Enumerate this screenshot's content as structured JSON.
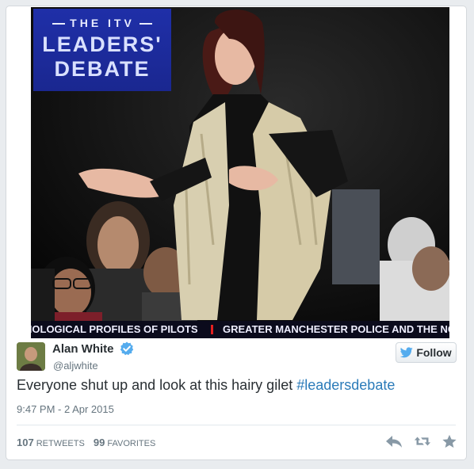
{
  "media": {
    "badge": {
      "line_top": "THE ITV",
      "line_1": "LEADERS'",
      "line_2": "DEBATE"
    },
    "ticker": {
      "left_text": "HOLOGICAL PROFILES OF PILOTS",
      "right_text": "GREATER MANCHESTER POLICE AND THE NO"
    }
  },
  "tweet": {
    "user_name": "Alan White",
    "handle": "@aljwhite",
    "follow_label": "Follow",
    "text_plain": "Everyone shut up and look at this hairy gilet",
    "hashtag": "#leadersdebate",
    "timestamp": "9:47 PM - 2 Apr 2015",
    "retweets_count": "107",
    "retweets_label": "RETWEETS",
    "favorites_count": "99",
    "favorites_label": "FAVORITES"
  },
  "icons": {
    "reply": "reply-icon",
    "retweet": "retweet-icon",
    "favorite": "star-icon",
    "twitter_bird": "twitter-bird-icon",
    "verified": "verified-badge-icon"
  },
  "colors": {
    "link": "#2b7bb9",
    "text": "#292f33",
    "muted": "#66757f",
    "verified": "#55acee"
  }
}
